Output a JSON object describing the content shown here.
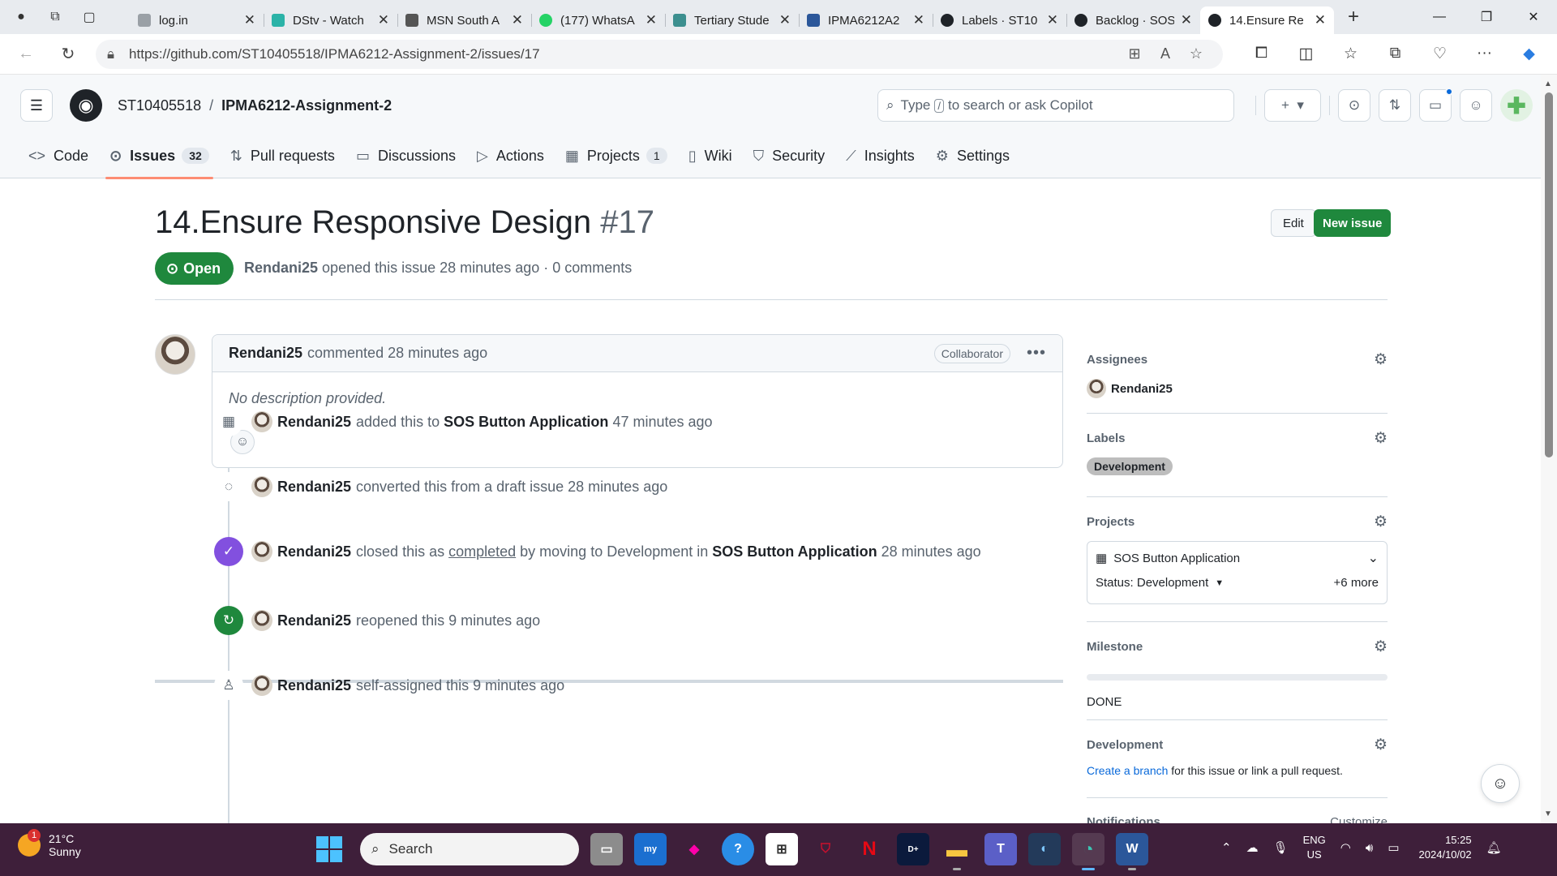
{
  "browser": {
    "tabs": [
      {
        "title": "log.in",
        "color": "#9aa0a6"
      },
      {
        "title": "DStv - Watch",
        "color": "#2bb3a8"
      },
      {
        "title": "MSN South A",
        "color": "#555555"
      },
      {
        "title": "(177) WhatsA",
        "color": "#25d366"
      },
      {
        "title": "Tertiary Stude",
        "color": "#3c8f8f"
      },
      {
        "title": "IPMA6212A2",
        "color": "#2b579a"
      },
      {
        "title": "Labels · ST10",
        "color": "#1f2328"
      },
      {
        "title": "Backlog · SOS",
        "color": "#1f2328"
      },
      {
        "title": "14.Ensure Re",
        "color": "#1f2328"
      }
    ],
    "url": "https://github.com/ST10405518/IPMA6212-Assignment-2/issues/17"
  },
  "header": {
    "owner": "ST10405518",
    "separator": "/",
    "repo": "IPMA6212-Assignment-2",
    "search_pre": "Type",
    "search_key": "/",
    "search_post": "to search or ask Copilot"
  },
  "repo_tabs": [
    {
      "label": "Code",
      "icon": "<>",
      "count": ""
    },
    {
      "label": "Issues",
      "icon": "⊙",
      "count": "32"
    },
    {
      "label": "Pull requests",
      "icon": "⇅",
      "count": ""
    },
    {
      "label": "Discussions",
      "icon": "▭",
      "count": ""
    },
    {
      "label": "Actions",
      "icon": "▷",
      "count": ""
    },
    {
      "label": "Projects",
      "icon": "▦",
      "count": "1"
    },
    {
      "label": "Wiki",
      "icon": "▯",
      "count": ""
    },
    {
      "label": "Security",
      "icon": "⛉",
      "count": ""
    },
    {
      "label": "Insights",
      "icon": "⟋",
      "count": ""
    },
    {
      "label": "Settings",
      "icon": "⚙",
      "count": ""
    }
  ],
  "issue": {
    "title": "14.Ensure Responsive Design",
    "number": "#17",
    "state": "Open",
    "author": "Rendani25",
    "opened_text": "opened this issue 28 minutes ago · 0 comments",
    "edit_label": "Edit",
    "new_label": "New issue"
  },
  "comment": {
    "author": "Rendani25",
    "action": "commented 28 minutes ago",
    "role": "Collaborator",
    "body": "No description provided."
  },
  "timeline": {
    "e1": {
      "user": "Rendani25",
      "t1": "added this to",
      "target": "SOS Button Application",
      "t2": "47 minutes ago"
    },
    "e2": {
      "user": "Rendani25",
      "t1": "converted this from a draft issue 28 minutes ago"
    },
    "e3": {
      "user": "Rendani25",
      "t1": "closed this as",
      "link": "completed",
      "t2": "by moving to Development in",
      "target": "SOS Button Application",
      "t3": "28 minutes ago"
    },
    "e4": {
      "user": "Rendani25",
      "t1": "reopened this 9 minutes ago"
    },
    "e5": {
      "user": "Rendani25",
      "t1": "self-assigned this 9 minutes ago"
    }
  },
  "sidebar": {
    "assignees_h": "Assignees",
    "assignee": "Rendani25",
    "labels_h": "Labels",
    "label": "Development",
    "label_color": "#bdbdbd",
    "projects_h": "Projects",
    "project_name": "SOS Button Application",
    "project_status": "Status: Development",
    "project_more": "+6 more",
    "milestone_h": "Milestone",
    "milestone_name": "DONE",
    "milestone_progress": 0,
    "development_h": "Development",
    "dev_link": "Create a branch",
    "dev_text": "for this issue or link a pull request.",
    "notifications_h": "Notifications",
    "customize": "Customize"
  },
  "taskbar": {
    "temp": "21°C",
    "condition": "Sunny",
    "weather_badge": "1",
    "search": "Search",
    "lang1": "ENG",
    "lang2": "US",
    "time": "15:25",
    "date": "2024/10/02"
  },
  "colors": {
    "accent_green": "#1f883d",
    "tab_underline": "#fd8c73",
    "link": "#0969da",
    "closed_purple": "#8250df"
  }
}
